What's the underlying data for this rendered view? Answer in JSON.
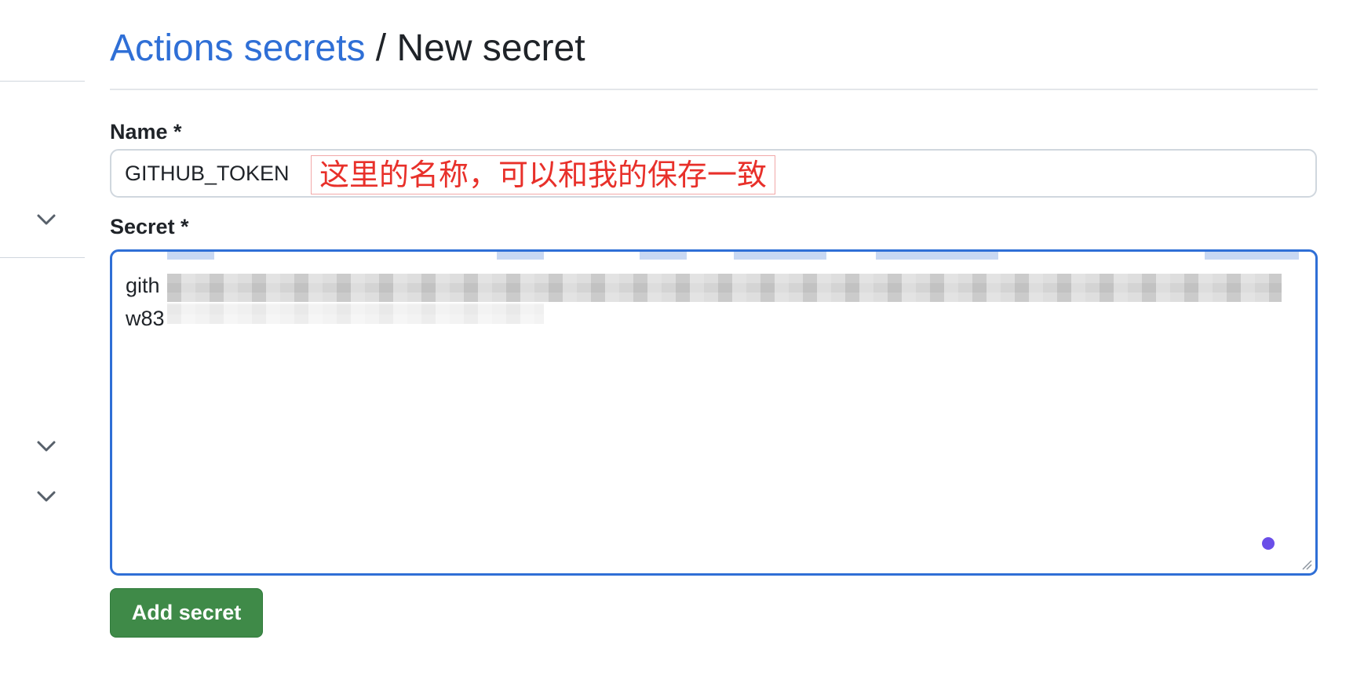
{
  "breadcrumb": {
    "parent_label": "Actions secrets",
    "separator": "/",
    "current_label": "New secret"
  },
  "name_field": {
    "label": "Name *",
    "value": "GITHUB_TOKEN"
  },
  "annotation": {
    "text": "这里的名称，可以和我的保存一致",
    "color": "#e8302a"
  },
  "secret_field": {
    "label": "Secret *",
    "line1": "gith",
    "line2": "w83",
    "redacted": true
  },
  "actions": {
    "submit_label": "Add secret"
  },
  "sidebar": {
    "chevron_icon": "chevron-down-icon",
    "chevron_count": 3
  },
  "colors": {
    "link": "#2f6fd6",
    "focus_border": "#2f6fd6",
    "button_bg": "#3f8a48",
    "annotation_red": "#e8302a"
  }
}
